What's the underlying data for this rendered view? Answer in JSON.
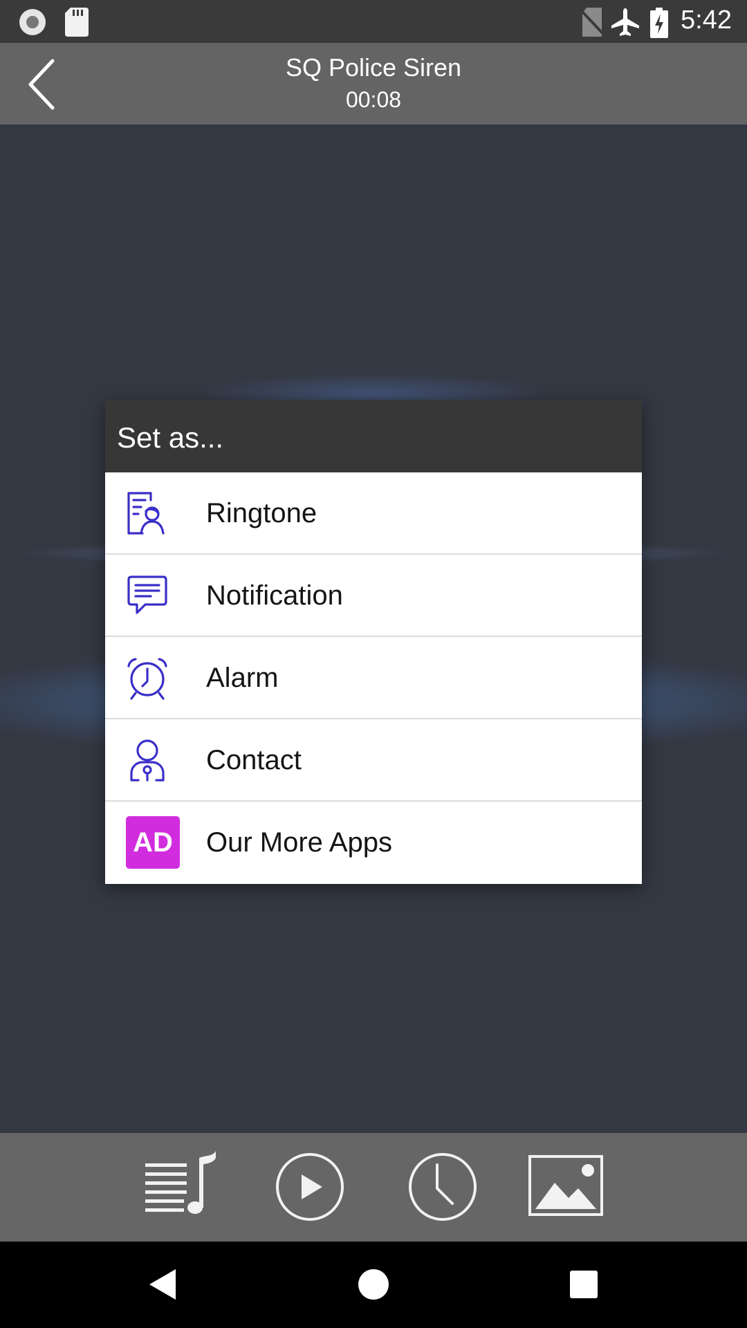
{
  "status_bar": {
    "time": "5:42",
    "icons": [
      "record-icon",
      "sd-card-icon",
      "no-sim-icon",
      "airplane-mode-icon",
      "battery-charging-icon"
    ]
  },
  "header": {
    "title": "SQ Police Siren",
    "duration": "00:08",
    "back_icon": "back-arrow-icon"
  },
  "dialog": {
    "title": "Set as...",
    "items": [
      {
        "label": "Ringtone",
        "icon": "ringtone-icon"
      },
      {
        "label": "Notification",
        "icon": "notification-icon"
      },
      {
        "label": "Alarm",
        "icon": "alarm-icon"
      },
      {
        "label": "Contact",
        "icon": "contact-icon"
      },
      {
        "label": "Our More Apps",
        "icon": "ad-icon",
        "badge": "AD"
      }
    ]
  },
  "toolbar": {
    "buttons": [
      "playlist-icon",
      "play-icon",
      "clock-icon",
      "image-icon"
    ]
  },
  "navbar": {
    "buttons": [
      "back-triangle-icon",
      "home-circle-icon",
      "recents-square-icon"
    ]
  },
  "colors": {
    "icon_accent": "#3a2fc8",
    "ad_badge": "#d12cde",
    "header_bg": "#646464",
    "dialog_title_bg": "#373737"
  }
}
